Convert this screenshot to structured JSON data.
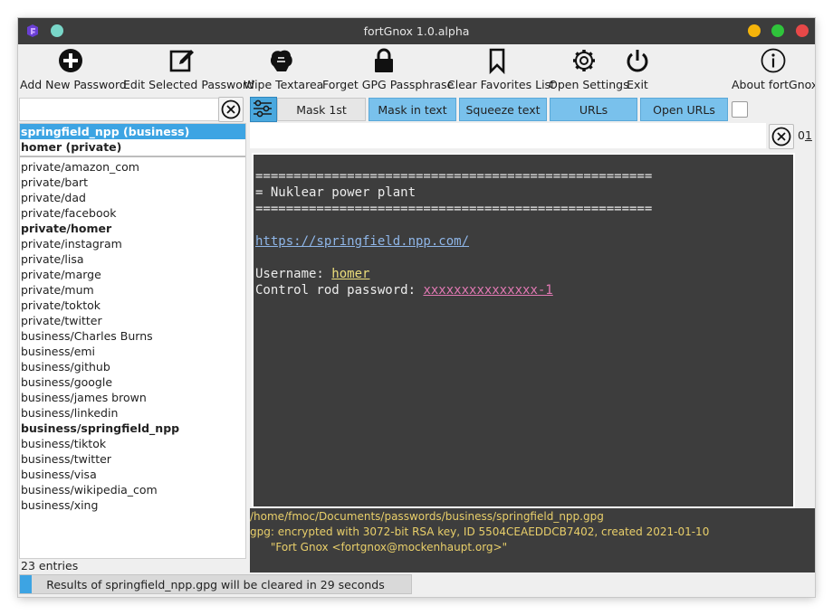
{
  "window": {
    "title": "fortGnox 1.0.alpha",
    "controls": {
      "minimize_color": "#f5b40a",
      "maximize_color": "#2fc43b",
      "close_color": "#e74848",
      "app_dot_color": "#79d6c8"
    }
  },
  "toolbar": {
    "add_password": "Add New Password",
    "edit_password": "Edit Selected Password",
    "wipe_textarea": "Wipe Textarea",
    "forget_gpg": "Forget GPG Passphrase",
    "clear_favorites": "Clear Favorites List",
    "open_settings": "Open Settings",
    "exit": "Exit",
    "about": "About fortGnox"
  },
  "search": {
    "value": "",
    "placeholder": ""
  },
  "filters": {
    "mask_1st": "Mask 1st",
    "mask_in_text": "Mask in text",
    "squeeze_text": "Squeeze text",
    "urls": "URLs",
    "open_urls": "Open URLs",
    "checkbox_checked": false
  },
  "favorites": [
    {
      "label": "springfield_npp (business)",
      "selected": true
    },
    {
      "label": "homer (private)",
      "selected": false
    }
  ],
  "entries": [
    {
      "label": "private/amazon_com",
      "bold": false
    },
    {
      "label": "private/bart",
      "bold": false
    },
    {
      "label": "private/dad",
      "bold": false
    },
    {
      "label": "private/facebook",
      "bold": false
    },
    {
      "label": "private/homer",
      "bold": true
    },
    {
      "label": "private/instagram",
      "bold": false
    },
    {
      "label": "private/lisa",
      "bold": false
    },
    {
      "label": "private/marge",
      "bold": false
    },
    {
      "label": "private/mum",
      "bold": false
    },
    {
      "label": "private/toktok",
      "bold": false
    },
    {
      "label": "private/twitter",
      "bold": false
    },
    {
      "label": "business/Charles Burns",
      "bold": false
    },
    {
      "label": "business/emi",
      "bold": false
    },
    {
      "label": "business/github",
      "bold": false
    },
    {
      "label": "business/google",
      "bold": false
    },
    {
      "label": "business/james brown",
      "bold": false
    },
    {
      "label": "business/linkedin",
      "bold": false
    },
    {
      "label": "business/springfield_npp",
      "bold": true
    },
    {
      "label": "business/tiktok",
      "bold": false
    },
    {
      "label": "business/twitter",
      "bold": false
    },
    {
      "label": "business/visa",
      "bold": false
    },
    {
      "label": "business/wikipedia_com",
      "bold": false
    },
    {
      "label": "business/xing",
      "bold": false
    }
  ],
  "entry_count": "23 entries",
  "index_label": "01",
  "content": {
    "rule": "====================================================",
    "heading": "= Nuklear power plant",
    "url": "https://springfield.npp.com/",
    "username_label": "Username: ",
    "username": "homer",
    "password_label": "Control rod password: ",
    "password": "xxxxxxxxxxxxxxx-1"
  },
  "gpg_status": {
    "path": "/home/fmoc/Documents/passwords/business/springfield_npp.gpg",
    "key_info": "gpg: encrypted with 3072-bit RSA key, ID 5504CEAEDDCB7402, created 2021-01-10",
    "owner": "      \"Fort Gnox <fortgnox@mockenhaupt.org>\""
  },
  "progress": {
    "text": "Results of springfield_npp.gpg will be cleared in 29 seconds",
    "fraction": 0.03
  }
}
